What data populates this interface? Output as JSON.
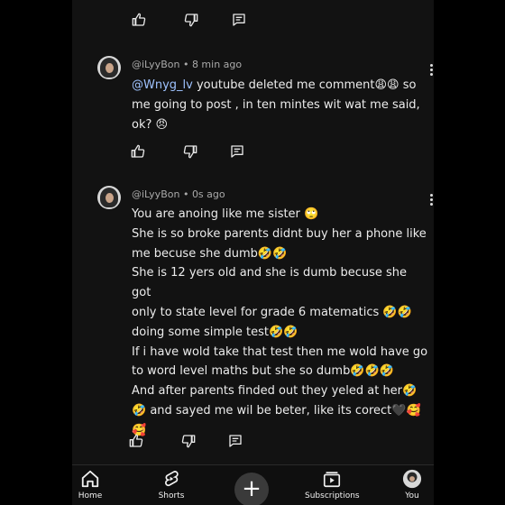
{
  "comments": [
    {
      "author": "@iLyyBon",
      "time": "8 min ago",
      "mention": "@Wnyg_lv",
      "text": " youtube deleted me comment😩😩 so\nme going to post , in ten mintes wit wat me said,\nok? 😠"
    },
    {
      "author": "@iLyyBon",
      "time": "0s ago",
      "text": "You are anoing like me sister 🙄\nShe is so broke parents didnt buy her a phone like\nme becuse she dumb🤣🤣\nShe is 12 yers old and she is dumb becuse she got\nonly to state level for grade 6 matematics 🤣🤣\ndoing some simple test🤣🤣\nIf i have wold take that test then me wold have go\nto word level maths but she so dumb🤣🤣🤣\nAnd after parents finded out they yeled at her🤣\n🤣 and sayed me wil be beter, like its corect🖤🥰\n🥰"
    }
  ],
  "separator": " • ",
  "nav": {
    "home": "Home",
    "shorts": "Shorts",
    "subscriptions": "Subscriptions",
    "you": "You"
  }
}
